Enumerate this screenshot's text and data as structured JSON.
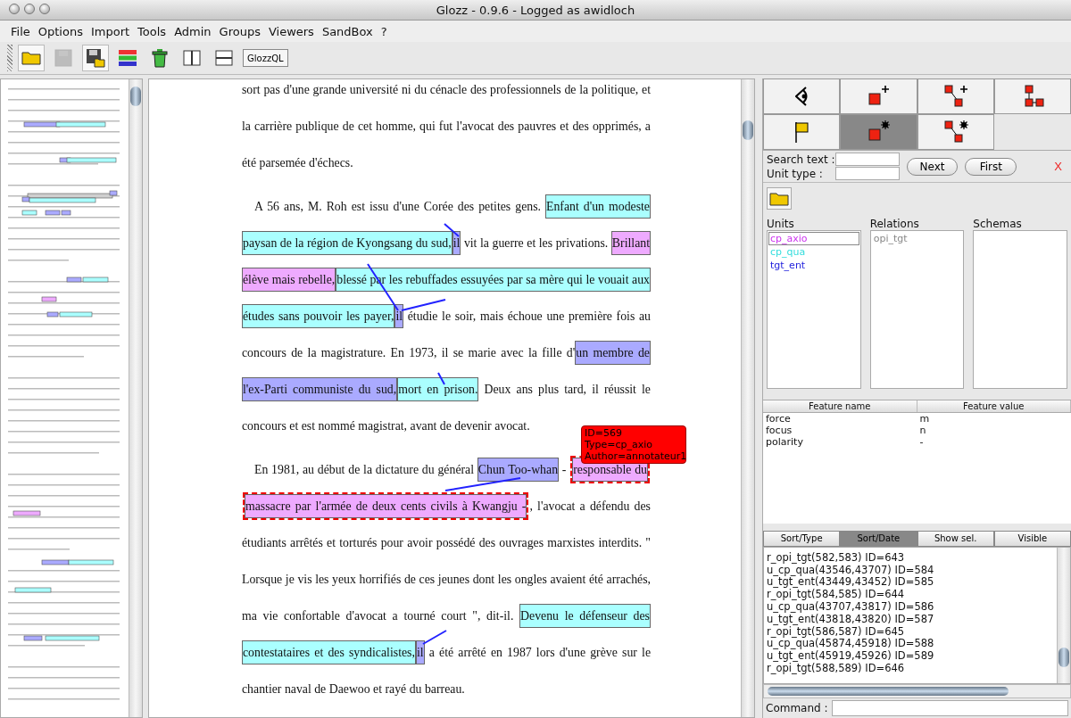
{
  "window": {
    "title": "Glozz - 0.9.6 - Logged as awidloch"
  },
  "menu": [
    "File",
    "Options",
    "Import",
    "Tools",
    "Admin",
    "Groups",
    "Viewers",
    "SandBox",
    "?"
  ],
  "toolbar": [
    {
      "kind": "open",
      "disabled": false
    },
    {
      "kind": "save",
      "disabled": true
    },
    {
      "kind": "saveas",
      "disabled": false
    },
    {
      "kind": "bars",
      "disabled": false
    },
    {
      "kind": "trash",
      "disabled": false
    },
    {
      "kind": "cols",
      "disabled": false
    },
    {
      "kind": "rows",
      "disabled": false
    },
    {
      "kind": "text",
      "label": "GlozzQL",
      "disabled": false
    }
  ],
  "document": {
    "paragraphs": [
      {
        "indent": false,
        "lines": [
          [
            {
              "kind": "text",
              "text": "sort pas d'une grande université ni du cénacle des professionnels de la politique, et"
            }
          ],
          [
            {
              "kind": "text",
              "text": "la carrière publique de cet homme, qui fut l'avocat des pauvres et des opprimés, a"
            }
          ],
          [
            {
              "kind": "text",
              "text": "été parsemée d'échecs."
            }
          ]
        ]
      },
      {
        "indent": true,
        "lines": [
          [
            {
              "kind": "text",
              "text": "A 56 ans, M. Roh est issu d'une Corée des petites gens. "
            },
            {
              "kind": "cp_qua",
              "text": "Enfant d'un modeste",
              "selected": false
            }
          ],
          [
            {
              "kind": "cp_qua",
              "text": "paysan de la région de Kyongsang du sud,",
              "selected": false
            },
            {
              "kind": "tgt_ent",
              "text": "il",
              "selected": false
            },
            {
              "kind": "text",
              "text": " vit la guerre et les privations. "
            },
            {
              "kind": "cp_axio",
              "text": "Brillant",
              "selected": false
            }
          ],
          [
            {
              "kind": "cp_axio",
              "text": "élève mais rebelle,",
              "selected": false
            },
            {
              "kind": "cp_qua",
              "text": "blessé par les rebuffades essuyées par sa mère qui le vouait aux",
              "selected": false
            }
          ],
          [
            {
              "kind": "cp_qua",
              "text": "études sans pouvoir les payer,",
              "selected": false
            },
            {
              "kind": "tgt_ent",
              "text": "il",
              "selected": false
            },
            {
              "kind": "text",
              "text": " étudie le soir, mais échoue une première fois au"
            }
          ],
          [
            {
              "kind": "text",
              "text": "concours de la magistrature. En 1973, il se marie avec la fille d'"
            },
            {
              "kind": "tgt_ent",
              "text": "un membre de",
              "selected": false
            }
          ],
          [
            {
              "kind": "tgt_ent",
              "text": "l'ex-Parti communiste du sud,",
              "selected": false
            },
            {
              "kind": "cp_qua",
              "text": "mort en prison.",
              "selected": false
            },
            {
              "kind": "text",
              "text": " Deux ans plus tard, il réussit le"
            }
          ],
          [
            {
              "kind": "text",
              "text": "concours et est nommé magistrat, avant de devenir avocat."
            }
          ]
        ]
      },
      {
        "indent": true,
        "lines": [
          [
            {
              "kind": "text",
              "text": "En 1981, au début de la dictature du général "
            },
            {
              "kind": "tgt_ent",
              "text": "Chun Too-whan",
              "selected": false
            },
            {
              "kind": "text",
              "text": " - "
            },
            {
              "kind": "cp_axio",
              "text": "responsable du",
              "selected": true
            }
          ],
          [
            {
              "kind": "cp_axio",
              "text": "massacre par l'armée de deux cents civils à Kwangju -",
              "selected": true
            },
            {
              "kind": "text",
              "text": ", l'avocat a défendu des"
            }
          ],
          [
            {
              "kind": "text",
              "text": "étudiants arrêtés et torturés pour avoir possédé des ouvrages marxistes interdits. \""
            }
          ],
          [
            {
              "kind": "text",
              "text": "Lorsque je vis les yeux horrifiés de ces jeunes dont les ongles avaient été arrachés,"
            }
          ],
          [
            {
              "kind": "text",
              "text": "ma vie confortable d'avocat a tourné court \", dit-il. "
            },
            {
              "kind": "cp_qua",
              "text": "Devenu le défenseur des",
              "selected": false
            }
          ],
          [
            {
              "kind": "cp_qua",
              "text": "contestataires et des syndicalistes,",
              "selected": false
            },
            {
              "kind": "tgt_ent",
              "text": "il",
              "selected": false
            },
            {
              "kind": "text",
              "text": " a été arrêté en 1987 lors d'une grève sur le"
            }
          ],
          [
            {
              "kind": "text",
              "text": "chantier naval de Daewoo et rayé du barreau."
            }
          ]
        ]
      }
    ]
  },
  "tooltip": {
    "lines": [
      "ID=569",
      "Type=cp_axio",
      "Author=annotateur1"
    ]
  },
  "tools": [
    {
      "kind": "eye",
      "selected": false
    },
    {
      "kind": "unit_add",
      "selected": false
    },
    {
      "kind": "relation_add",
      "selected": false
    },
    {
      "kind": "schema",
      "selected": false
    },
    {
      "kind": "flag",
      "selected": false
    },
    {
      "kind": "unit_edit",
      "selected": true
    },
    {
      "kind": "relation_edit",
      "selected": false
    }
  ],
  "search": {
    "text_label": "Search text :",
    "type_label": "Unit type :",
    "buttons": [
      "Next",
      "First"
    ],
    "close": "X"
  },
  "lists": {
    "units": {
      "title": "Units",
      "items": [
        {
          "label": "cp_axio",
          "color": "#cc33ee",
          "selected": true
        },
        {
          "label": "cp_qua",
          "color": "#33dddd",
          "selected": false
        },
        {
          "label": "tgt_ent",
          "color": "#2222dd",
          "selected": false
        }
      ]
    },
    "relations": {
      "title": "Relations",
      "items": [
        {
          "label": "opi_tgt",
          "color": "#888888",
          "selected": false
        }
      ]
    },
    "schemas": {
      "title": "Schemas"
    }
  },
  "features": {
    "columns": [
      "Feature name",
      "Feature value"
    ],
    "rows": [
      [
        "force",
        "m"
      ],
      [
        "focus",
        "n"
      ],
      [
        "polarity",
        "-"
      ]
    ]
  },
  "sort_tabs": [
    {
      "label": "Sort/Type",
      "selected": false
    },
    {
      "label": "Sort/Date",
      "selected": true
    },
    {
      "label": "Show sel.",
      "selected": false
    },
    {
      "label": "Visible",
      "selected": false
    }
  ],
  "annotations": [
    "r_opi_tgt(582,583) ID=643",
    "u_cp_qua(43546,43707) ID=584",
    "u_tgt_ent(43449,43452) ID=585",
    "r_opi_tgt(584,585) ID=644",
    "u_cp_qua(43707,43817) ID=586",
    "u_tgt_ent(43818,43820) ID=587",
    "r_opi_tgt(586,587) ID=645",
    "u_cp_qua(45874,45918) ID=588",
    "u_tgt_ent(45919,45926) ID=589",
    "r_opi_tgt(588,589) ID=646"
  ],
  "command": {
    "label": "Command :"
  }
}
